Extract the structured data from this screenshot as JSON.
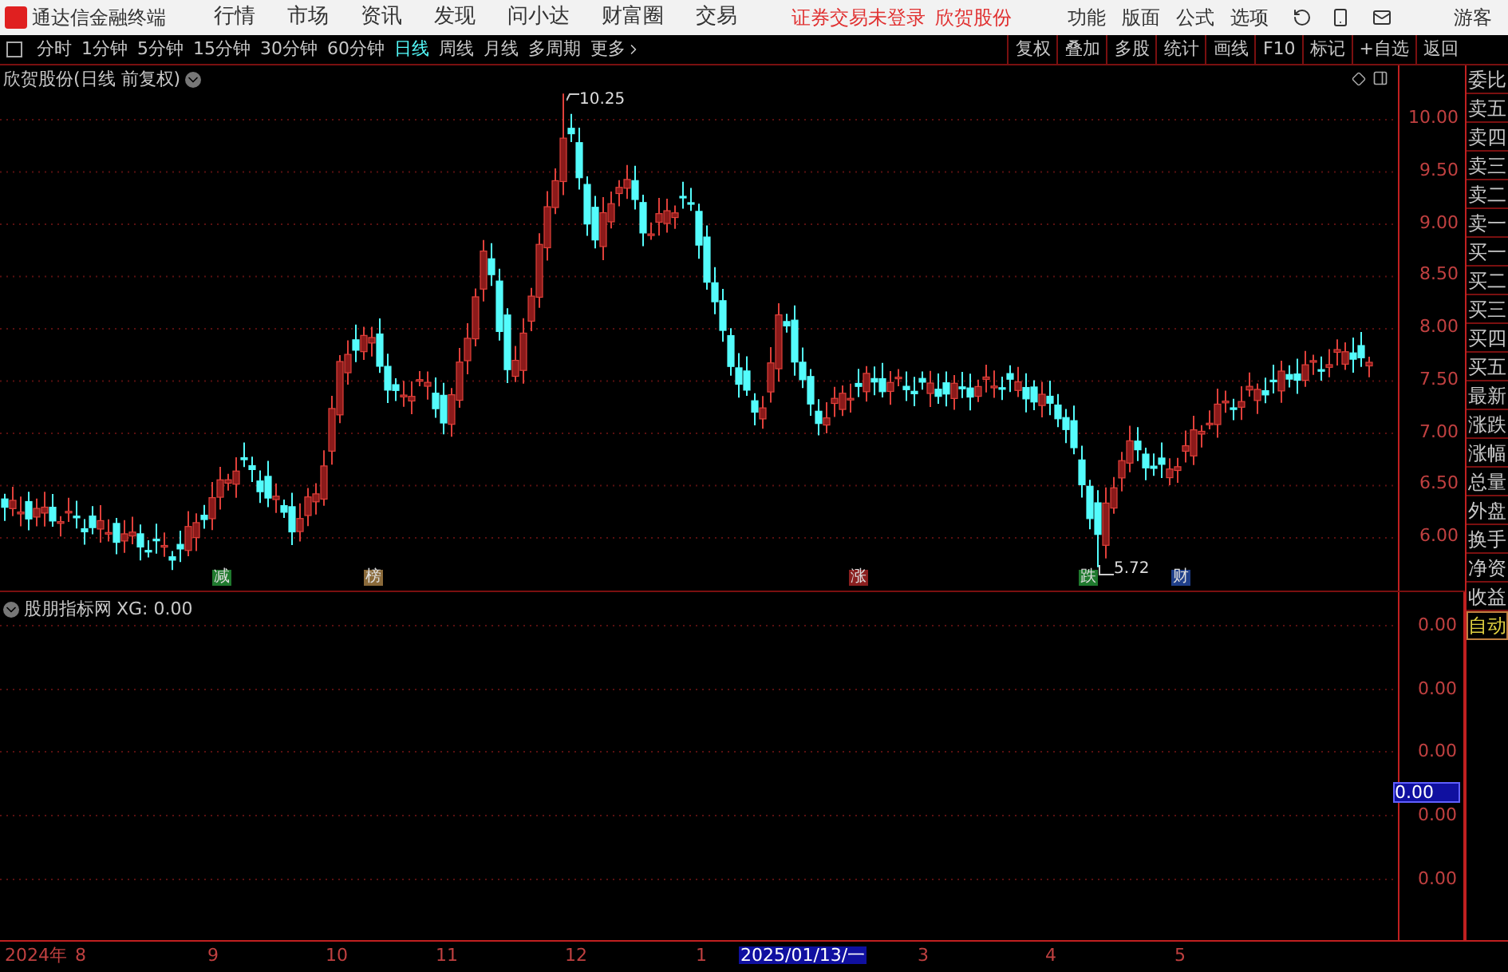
{
  "title_bar": {
    "app_name": "通达信金融终端",
    "menu": [
      "行情",
      "市场",
      "资讯",
      "发现",
      "问小达",
      "财富圈",
      "交易"
    ],
    "status": "证券交易未登录",
    "stock": "欣贺股份",
    "menu_right": [
      "功能",
      "版面",
      "公式",
      "选项"
    ],
    "user": "游客"
  },
  "periods": [
    {
      "label": "分时",
      "selected": false
    },
    {
      "label": "1分钟",
      "selected": false
    },
    {
      "label": "5分钟",
      "selected": false
    },
    {
      "label": "15分钟",
      "selected": false
    },
    {
      "label": "30分钟",
      "selected": false
    },
    {
      "label": "60分钟",
      "selected": false
    },
    {
      "label": "日线",
      "selected": true
    },
    {
      "label": "周线",
      "selected": false
    },
    {
      "label": "月线",
      "selected": false
    },
    {
      "label": "多周期",
      "selected": false
    }
  ],
  "more": "更多",
  "tools": [
    "复权",
    "叠加",
    "多股",
    "统计",
    "画线",
    "F10",
    "标记",
    "+自选",
    "返回"
  ],
  "main_chart": {
    "title": "欣贺股份(日线 前复权)",
    "high_label": "10.25",
    "low_label": "5.72",
    "price_ticks": [
      "10.00",
      "9.50",
      "9.00",
      "8.50",
      "8.00",
      "7.50",
      "7.00",
      "6.50",
      "6.00"
    ],
    "markers": [
      {
        "label": "减",
        "color": "#1f7a2e"
      },
      {
        "label": "榜",
        "color": "#8a6a3a"
      },
      {
        "label": "涨",
        "color": "#8a1f1f"
      },
      {
        "label": "跌",
        "color": "#1f7a2e"
      },
      {
        "label": "财",
        "color": "#1f3f8a"
      }
    ]
  },
  "indicator": {
    "name": "股朋指标网",
    "value": "XG: 0.00",
    "ticks": [
      "0.00",
      "0.00",
      "0.00",
      "0.00",
      "0.00"
    ],
    "cursor_value": "0.00"
  },
  "side_panel": [
    {
      "label": "委比",
      "kind": "field"
    },
    {
      "label": "卖五",
      "kind": "field"
    },
    {
      "label": "卖四",
      "kind": "field"
    },
    {
      "label": "卖三",
      "kind": "field"
    },
    {
      "label": "卖二",
      "kind": "field"
    },
    {
      "label": "卖一",
      "kind": "field"
    },
    {
      "label": "买一",
      "kind": "field"
    },
    {
      "label": "买二",
      "kind": "field"
    },
    {
      "label": "买三",
      "kind": "field"
    },
    {
      "label": "买四",
      "kind": "field"
    },
    {
      "label": "买五",
      "kind": "field"
    },
    {
      "label": "最新",
      "kind": "field"
    },
    {
      "label": "涨跌",
      "kind": "field"
    },
    {
      "label": "涨幅",
      "kind": "field"
    },
    {
      "label": "总量",
      "kind": "field"
    },
    {
      "label": "外盘",
      "kind": "field"
    },
    {
      "label": "换手",
      "kind": "field"
    },
    {
      "label": "净资",
      "kind": "field"
    },
    {
      "label": "收益",
      "kind": "field"
    },
    {
      "label": "自动",
      "kind": "button"
    }
  ],
  "time_axis": [
    {
      "label": "2024年",
      "selected": false
    },
    {
      "label": "8",
      "selected": false
    },
    {
      "label": "9",
      "selected": false
    },
    {
      "label": "10",
      "selected": false
    },
    {
      "label": "11",
      "selected": false
    },
    {
      "label": "12",
      "selected": false
    },
    {
      "label": "1",
      "selected": false
    },
    {
      "label": "2025/01/13/一",
      "selected": true
    },
    {
      "label": "3",
      "selected": false
    },
    {
      "label": "4",
      "selected": false
    },
    {
      "label": "5",
      "selected": false
    }
  ]
}
